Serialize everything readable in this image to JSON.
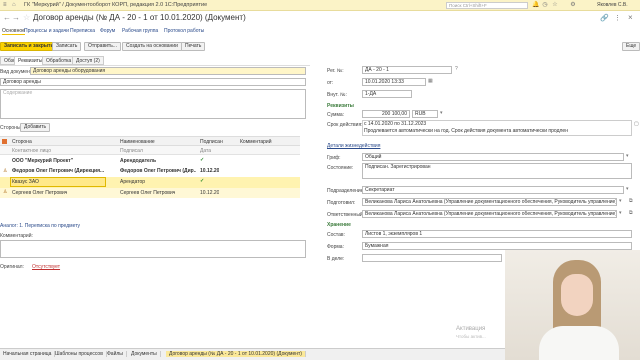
{
  "app": {
    "title": "ГК \"Меркурий\" / Документооборот КОРП, редакция 2.0 1С:Предприятие",
    "search_placeholder": "Поиск Ctrl+Shift+F",
    "user": "Яковлев С.В."
  },
  "window": {
    "back": "←",
    "forward": "→",
    "star": "☆",
    "title": "Договор аренды (№ ДА - 20 - 1 от 10.01.2020) (Документ)",
    "link_icon": "🔗",
    "more_icon": "⋮",
    "close_icon": "×"
  },
  "nav_links": [
    {
      "label": "Основное",
      "active": true
    },
    {
      "label": "Процессы и задачи"
    },
    {
      "label": "Переписка"
    },
    {
      "label": "Форум"
    },
    {
      "label": "Рабочая группа"
    },
    {
      "label": "Протокол работы"
    }
  ],
  "toolbar": {
    "save_close": "Записать и закрыть",
    "save": "Записать",
    "send": "Отправить...",
    "create_based": "Создать на основании",
    "print": "Печать",
    "more": "Еще"
  },
  "tabs": [
    {
      "label": "Обзор"
    },
    {
      "label": "Реквизиты",
      "active": true
    },
    {
      "label": "Обработка"
    },
    {
      "label": "Доступ (2)"
    }
  ],
  "left": {
    "doc_type_label": "Вид документа:",
    "doc_type_value": "Договор аренды оборудования",
    "name_value": "Договор аренды",
    "content_placeholder": "Содержание",
    "parties_label": "Стороны:",
    "add_button": "Добавить",
    "table_headers": {
      "party": "Сторона",
      "name": "Наименование",
      "signed": "Подписан",
      "comment": "Комментарий",
      "contact": "Контактное лицо",
      "signer": "Подписал",
      "date": "Дата"
    },
    "rows": [
      {
        "party": "ООО \"Меркурий Проект\"",
        "name": "Арендодатель",
        "signed": "✓",
        "contact": "Федоров Олег Петрович (Дирекция...",
        "signer": "Федоров Олег Петрович (Дир...",
        "date": "10.12.20"
      },
      {
        "party": "Квазус ЗАО",
        "name": "Арендатор",
        "signed": "✓",
        "contact": "Сергеев Олег Петрович",
        "signer": "Сергеев Олег Петрович",
        "date": "10.12.20"
      }
    ],
    "relation_link": "Аналог: 1. Переписка по предмету",
    "comment_label": "Комментарий:",
    "original_label": "Оригинал:",
    "original_value": "Отсутствует"
  },
  "right": {
    "reg_no_label": "Рег. №:",
    "reg_no_value": "ДА - 20 - 1",
    "from_label": "от:",
    "from_value": "10.01.2020 13:33",
    "inc_no_label": "Внут. №:",
    "inc_no_value": "1-ДА",
    "requisites_title": "Реквизиты",
    "sum_label": "Сумма:",
    "sum_value": "200 100,00",
    "currency": "RUB",
    "term_label": "Срок действия:",
    "term_value": "с 14.01.2020 по 31.12.2023",
    "term_note": "Продлевается автоматически на год. Срок действия документа автоматически продлен",
    "workflow_link": "Детали жизнедействия",
    "stamp_label": "Гриф:",
    "stamp_value": "Общий",
    "state_label": "Состояние:",
    "state_value": "Подписан. Зарегистрирован",
    "department_label": "Подразделение:",
    "department_value": "Секретариат",
    "prepared_label": "Подготовил:",
    "prepared_value": "Великанова Лариса Анатольевна (Управление документационного обеспечения, Руководитель управление)",
    "responsible_label": "Ответственный:",
    "responsible_value": "Великанова Лариса Анатольевна (Управление документационного обеспечения, Руководитель управление)",
    "storage_title": "Хранение",
    "composition_label": "Состав:",
    "composition_value": "Листов 1, экземпляров 1",
    "form_label": "Форма:",
    "form_value": "Бумажная",
    "file_label": "В деле:"
  },
  "taskbar": [
    {
      "label": "Начальная страница"
    },
    {
      "label": "Шаблоны процессов"
    },
    {
      "label": "Файлы"
    },
    {
      "label": "Документы"
    },
    {
      "label": "Договор аренды (№ ДА - 20 - 1 от 10.01.2020) (Документ)",
      "active": true
    }
  ],
  "watermark": {
    "line1": "Активация",
    "line2": "Чтобы актив..."
  }
}
